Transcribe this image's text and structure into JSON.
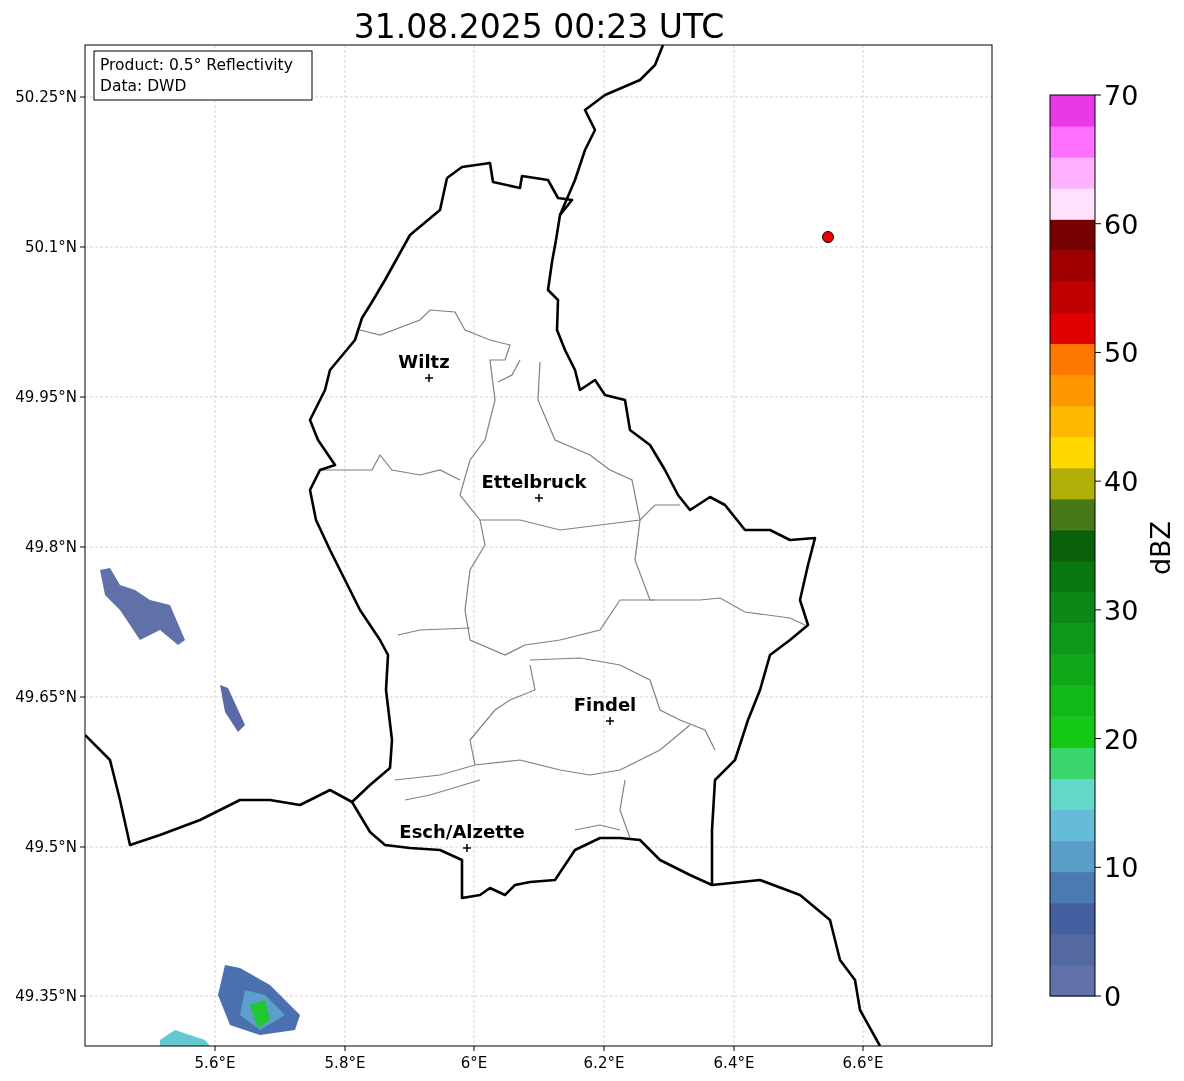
{
  "title": "31.08.2025 00:23 UTC",
  "info_box": {
    "lines": [
      "Product: 0.5° Reflectivity",
      "Data: DWD"
    ]
  },
  "x_ticks": [
    "5.6°E",
    "5.8°E",
    "6°E",
    "6.2°E",
    "6.4°E",
    "6.6°E"
  ],
  "y_ticks": [
    "50.25°N",
    "50.1°N",
    "49.95°N",
    "49.8°N",
    "49.65°N",
    "49.5°N",
    "49.35°N"
  ],
  "cities": [
    {
      "name": "Wiltz"
    },
    {
      "name": "Ettelbruck"
    },
    {
      "name": "Findel"
    },
    {
      "name": "Esch/Alzette"
    }
  ],
  "colorbar": {
    "label": "dBZ",
    "ticks": [
      "70",
      "60",
      "50",
      "40",
      "30",
      "20",
      "10",
      "0"
    ],
    "bins": [
      {
        "color": "#6272a8"
      },
      {
        "color": "#5469a0"
      },
      {
        "color": "#4560a0"
      },
      {
        "color": "#4a7ab0"
      },
      {
        "color": "#5a9ec8"
      },
      {
        "color": "#64bcd8"
      },
      {
        "color": "#64d8c8"
      },
      {
        "color": "#3cd46e"
      },
      {
        "color": "#14c814"
      },
      {
        "color": "#12b818"
      },
      {
        "color": "#10a818"
      },
      {
        "color": "#0c9818"
      },
      {
        "color": "#0c8818"
      },
      {
        "color": "#0a7810"
      },
      {
        "color": "#0a600a"
      },
      {
        "color": "#487818"
      },
      {
        "color": "#b0b008"
      },
      {
        "color": "#ffd800"
      },
      {
        "color": "#ffb800"
      },
      {
        "color": "#ff9800"
      },
      {
        "color": "#ff7800"
      },
      {
        "color": "#e00000"
      },
      {
        "color": "#c00000"
      },
      {
        "color": "#a00000"
      },
      {
        "color": "#780000"
      },
      {
        "color": "#ffe0ff"
      },
      {
        "color": "#ffb0ff"
      },
      {
        "color": "#ff70ff"
      },
      {
        "color": "#e838e8"
      }
    ]
  }
}
